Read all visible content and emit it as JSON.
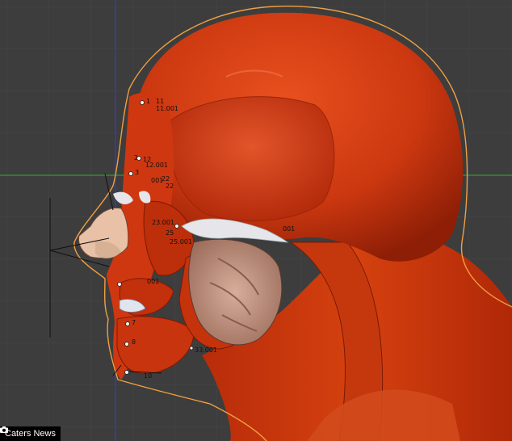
{
  "viewport": {
    "background_color": "#3d3d3d",
    "grid_color": "#474747",
    "x_axis_color": "#2e8b2e",
    "y_axis_color": "#3a3ad0",
    "outline_color": "#f0a040"
  },
  "model": {
    "muscle_color": "#d2360c",
    "skull_color": "#c83a14",
    "tendon_color": "#e6e6ea",
    "masseter_color": "#c79a86",
    "nose_cartilage_color": "#e8c1a6"
  },
  "bone_labels": [
    {
      "id": "b1",
      "text": "1"
    },
    {
      "id": "b11",
      "text": "11"
    },
    {
      "id": "b11001",
      "text": "11.001"
    },
    {
      "id": "b2",
      "text": "2"
    },
    {
      "id": "b12",
      "text": "12"
    },
    {
      "id": "b12001",
      "text": "12.001"
    },
    {
      "id": "b3",
      "text": "3"
    },
    {
      "id": "b001",
      "text": "001"
    },
    {
      "id": "b22",
      "text": "22"
    },
    {
      "id": "b22b",
      "text": "22"
    },
    {
      "id": "b23001",
      "text": "23.001"
    },
    {
      "id": "b25",
      "text": "25"
    },
    {
      "id": "b25001",
      "text": "25.001"
    },
    {
      "id": "b001b",
      "text": "001"
    },
    {
      "id": "b7",
      "text": "7"
    },
    {
      "id": "b8",
      "text": "8"
    },
    {
      "id": "b33001",
      "text": "33.001"
    },
    {
      "id": "b10",
      "text": "10"
    },
    {
      "id": "b001c",
      "text": "001"
    }
  ],
  "credit": {
    "text": "Caters News"
  }
}
